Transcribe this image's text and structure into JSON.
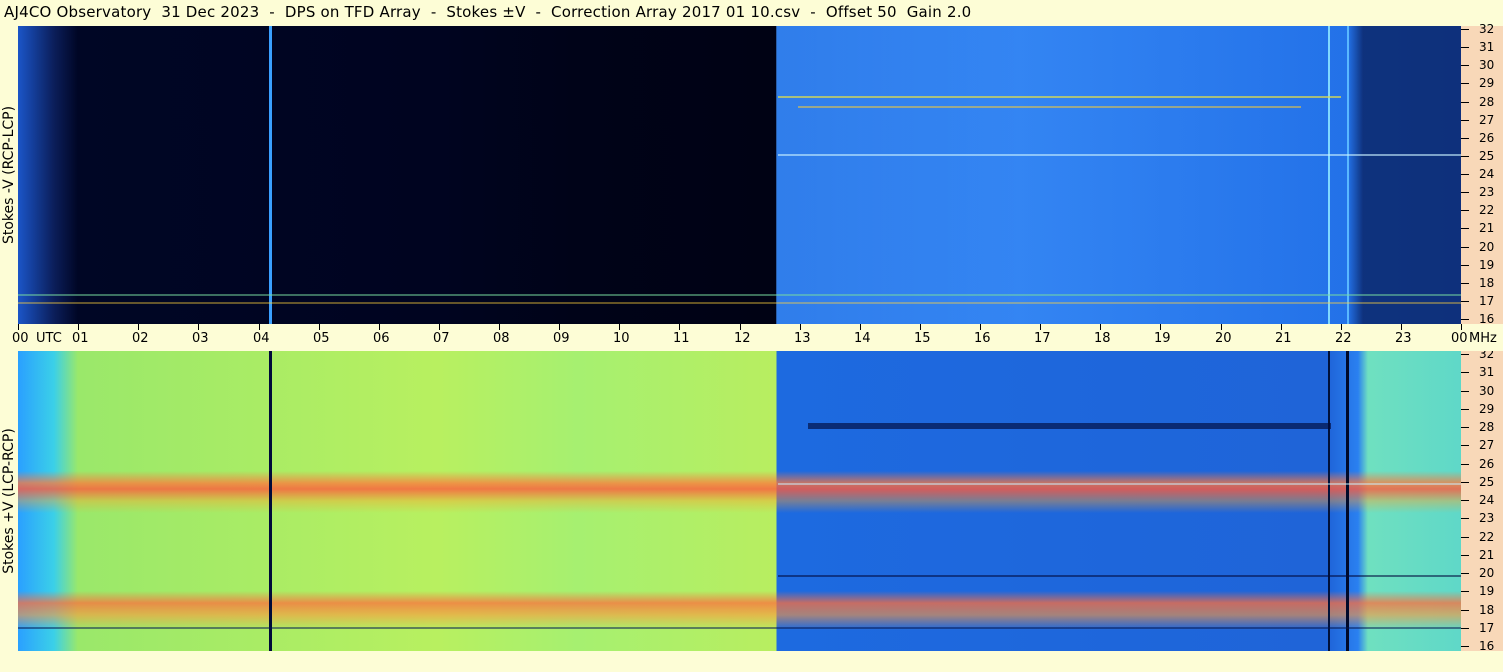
{
  "title": "AJ4CO Observatory  31 Dec 2023  -  DPS on TFD Array  -  Stokes ±V  -  Correction Array 2017 01 10.csv  -  Offset 50  Gain 2.0",
  "colors": {
    "background": "#fdfdd6",
    "axis_bg": "#f8d8b8"
  },
  "chart_data": [
    {
      "type": "heatmap",
      "panel": "top",
      "ylabel": "Stokes -V (RCP-LCP)",
      "y_unit": "MHz",
      "y_ticks": [
        "32",
        "31",
        "30",
        "29",
        "28",
        "27",
        "26",
        "25",
        "24",
        "23",
        "22",
        "21",
        "20",
        "19",
        "18",
        "17",
        "16"
      ],
      "ylim": [
        16,
        32
      ],
      "x_ticks": [
        "00",
        "01",
        "02",
        "03",
        "04",
        "05",
        "06",
        "07",
        "08",
        "09",
        "10",
        "11",
        "12",
        "13",
        "14",
        "15",
        "16",
        "17",
        "18",
        "19",
        "20",
        "21",
        "22",
        "23",
        "00"
      ],
      "x_unit": "UTC",
      "colormap": "jet"
    },
    {
      "type": "heatmap",
      "panel": "bottom",
      "ylabel": "Stokes +V (LCP-RCP)",
      "y_unit": "MHz",
      "y_ticks": [
        "32",
        "31",
        "30",
        "29",
        "28",
        "27",
        "26",
        "25",
        "24",
        "23",
        "22",
        "21",
        "20",
        "19",
        "18",
        "17",
        "16"
      ],
      "ylim": [
        16,
        32
      ],
      "x_ticks": [
        "00",
        "01",
        "02",
        "03",
        "04",
        "05",
        "06",
        "07",
        "08",
        "09",
        "10",
        "11",
        "12",
        "13",
        "14",
        "15",
        "16",
        "17",
        "18",
        "19",
        "20",
        "21",
        "22",
        "23",
        "00"
      ],
      "x_unit": "UTC",
      "colormap": "jet"
    }
  ]
}
